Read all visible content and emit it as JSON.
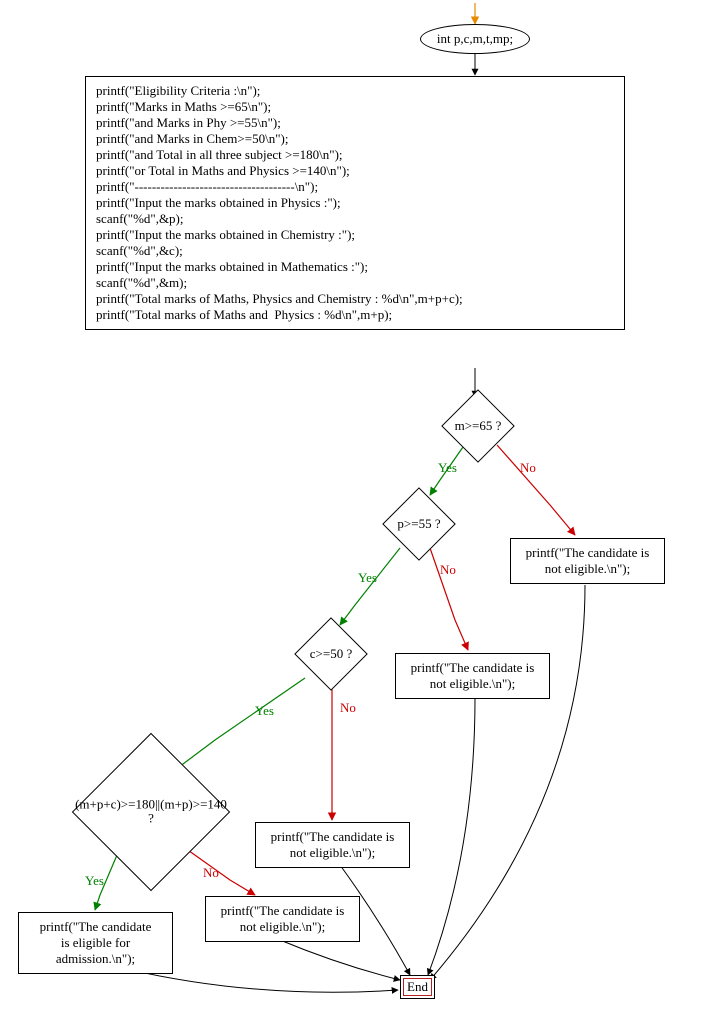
{
  "start_node": "int p,c,m,t,mp;",
  "block_lines": [
    "printf(\"Eligibility Criteria :\\n\");",
    "printf(\"Marks in Maths >=65\\n\");",
    "printf(\"and Marks in Phy >=55\\n\");",
    "printf(\"and Marks in Chem>=50\\n\");",
    "printf(\"and Total in all three subject >=180\\n\");",
    "printf(\"or Total in Maths and Physics >=140\\n\");",
    "printf(\"-------------------------------------\\n\");",
    "printf(\"Input the marks obtained in Physics :\");",
    "scanf(\"%d\",&p);",
    "printf(\"Input the marks obtained in Chemistry :\");",
    "scanf(\"%d\",&c);",
    "printf(\"Input the marks obtained in Mathematics :\");",
    "scanf(\"%d\",&m);",
    "printf(\"Total marks of Maths, Physics and Chemistry : %d\\n\",m+p+c);",
    "printf(\"Total marks of Maths and  Physics : %d\\n\",m+p);"
  ],
  "decisions": {
    "d1": "m>=65 ?",
    "d2": "p>=55 ?",
    "d3": "c>=50 ?",
    "d4_l1": "(m+p+c)>=180||(m+p)>=140",
    "d4_l2": "?"
  },
  "outputs": {
    "not_eligible_1": "printf(\"The candidate is\nnot eligible.\\n\");",
    "not_eligible_2": "printf(\"The candidate is\nnot eligible.\\n\");",
    "not_eligible_3": "printf(\"The candidate is\nnot eligible.\\n\");",
    "not_eligible_4": "printf(\"The candidate is\nnot eligible.\\n\");",
    "eligible": "printf(\"The  candidate\nis eligible for\nadmission.\\n\");"
  },
  "end_label": "End",
  "labels": {
    "yes": "Yes",
    "no": "No"
  },
  "colors": {
    "yes_edge": "#008000",
    "no_edge": "#cc0000",
    "normal_edge": "#000000",
    "start_arrow": "#e68a00"
  }
}
